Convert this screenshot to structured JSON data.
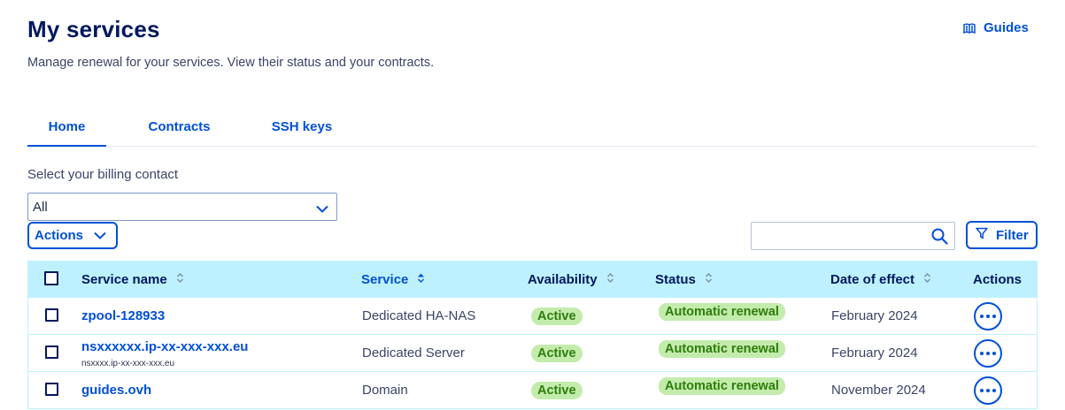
{
  "header": {
    "title": "My services",
    "subtitle": "Manage renewal for your services. View their status and your contracts.",
    "guides_label": "Guides"
  },
  "tabs": [
    {
      "label": "Home",
      "active": true
    },
    {
      "label": "Contracts",
      "active": false
    },
    {
      "label": "SSH keys",
      "active": false
    }
  ],
  "billing": {
    "label": "Select your billing contact",
    "selected": "All"
  },
  "toolbar": {
    "actions_label": "Actions",
    "search_value": "",
    "filter_label": "Filter"
  },
  "table": {
    "headers": {
      "service_name": "Service name",
      "service": "Service",
      "availability": "Availability",
      "status": "Status",
      "date_of_effect": "Date of effect",
      "actions": "Actions"
    },
    "rows": [
      {
        "name": "zpool-128933",
        "sub": "",
        "service": "Dedicated HA-NAS",
        "availability": "Active",
        "status": "Automatic renewal",
        "date": "February 2024"
      },
      {
        "name": "nsxxxxxx.ip-xx-xxx-xxx.eu",
        "sub": "nsxxxx.ip-xx-xxx-xxx.eu",
        "service": "Dedicated Server",
        "availability": "Active",
        "status": "Automatic renewal",
        "date": "February 2024"
      },
      {
        "name": "guides.ovh",
        "sub": "",
        "service": "Domain",
        "availability": "Active",
        "status": "Automatic renewal",
        "date": "November 2024"
      }
    ]
  },
  "colors": {
    "accent": "#0050d7",
    "title": "#00185e",
    "header_bg": "#bef1ff",
    "badge_bg": "#c3ecac",
    "badge_text": "#2e7d0c"
  },
  "icons": {
    "guides": "book-icon",
    "dropdown": "chevron-down-icon",
    "search": "search-icon",
    "filter": "filter-icon",
    "sort": "sort-icon",
    "more": "more-icon"
  }
}
